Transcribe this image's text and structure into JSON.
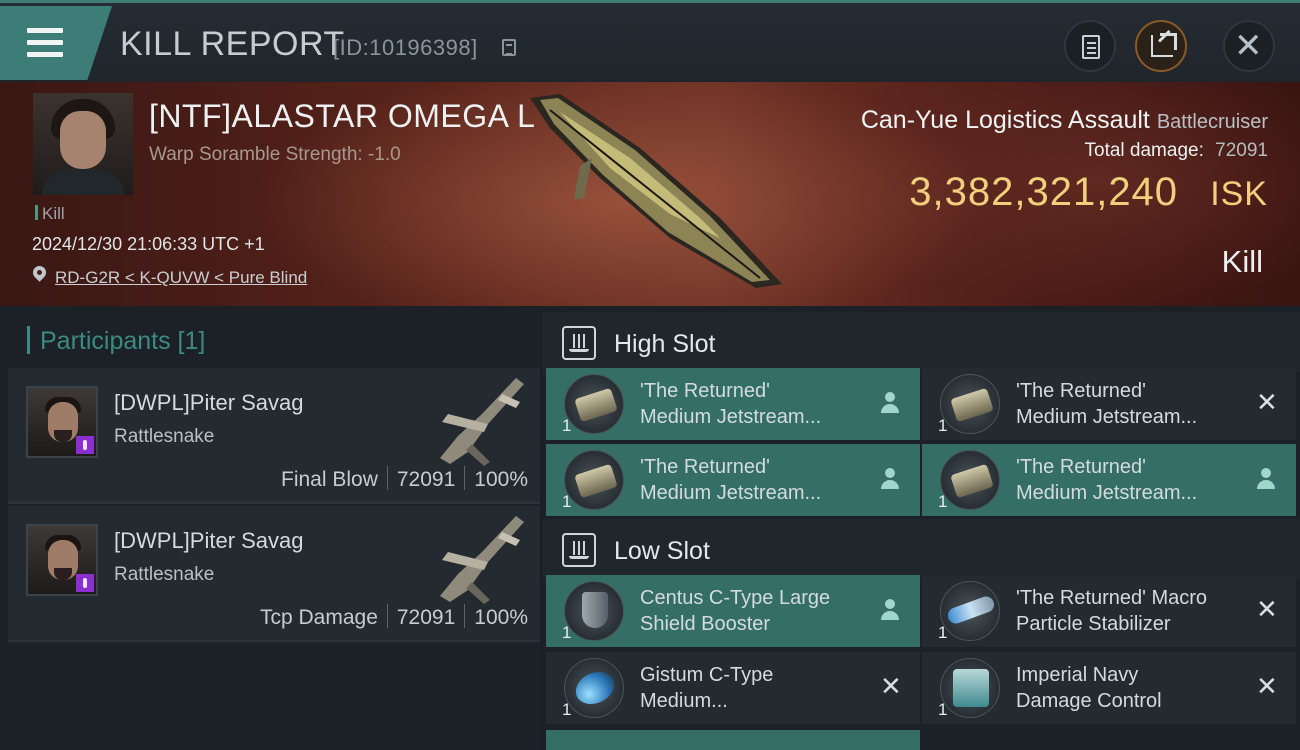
{
  "header": {
    "title": "KILL REPORT",
    "report_id": "[ID:10196398]",
    "icons": {
      "menu": "hamburger-menu-icon",
      "copy": "copy-icon",
      "report": "clipboard-icon",
      "share": "share-icon",
      "close": "close-icon"
    },
    "accent_color": "#3d7d77"
  },
  "victim": {
    "name": "[NTF]ALASTAR OMEGA L",
    "scramble": "Warp Soramble Strength: -1.0",
    "tag": "Kill",
    "datetime": "2024/12/30 21:06:33 UTC +1",
    "location": "RD-G2R < K-QUVW < Pure Blind",
    "ship_name": "Can-Yue Logistics Assault",
    "ship_class": "Battlecruiser",
    "total_damage_label": "Total damage:",
    "total_damage": "72091",
    "isk_value": "3,382,321,240",
    "isk_unit": "ISK",
    "result": "Kill",
    "isk_color": "#f3cf7d"
  },
  "participants": {
    "header": "Participants [1]",
    "rows": [
      {
        "name": "[DWPL]Piter Savag",
        "ship": "Rattlesnake",
        "role": "Final Blow",
        "damage": "72091",
        "percent": "100%"
      },
      {
        "name": "[DWPL]Piter Savag",
        "ship": "Rattlesnake",
        "role": "Tcp Damage",
        "damage": "72091",
        "percent": "100%"
      }
    ]
  },
  "fitting": {
    "high_slot": {
      "title": "High Slot",
      "modules": [
        {
          "line1": "'The Returned'",
          "line2": "Medium Jetstream...",
          "count": "1",
          "status": "person"
        },
        {
          "line1": "'The Returned'",
          "line2": "Medium Jetstream...",
          "count": "1",
          "status": "x"
        },
        {
          "line1": "'The Returned'",
          "line2": "Medium Jetstream...",
          "count": "1",
          "status": "person"
        },
        {
          "line1": "'The Returned'",
          "line2": "Medium Jetstream...",
          "count": "1",
          "status": "person"
        }
      ]
    },
    "low_slot": {
      "title": "Low Slot",
      "modules": [
        {
          "line1": "Centus C-Type Large",
          "line2": "Shield Booster",
          "count": "1",
          "status": "person"
        },
        {
          "line1": "'The Returned' Macro",
          "line2": "Particle Stabilizer",
          "count": "1",
          "status": "x"
        },
        {
          "line1": "Gistum C-Type",
          "line2": "Medium...",
          "count": "1",
          "status": "x"
        },
        {
          "line1": "Imperial Navy",
          "line2": "Damage Control",
          "count": "1",
          "status": "x"
        }
      ]
    }
  }
}
